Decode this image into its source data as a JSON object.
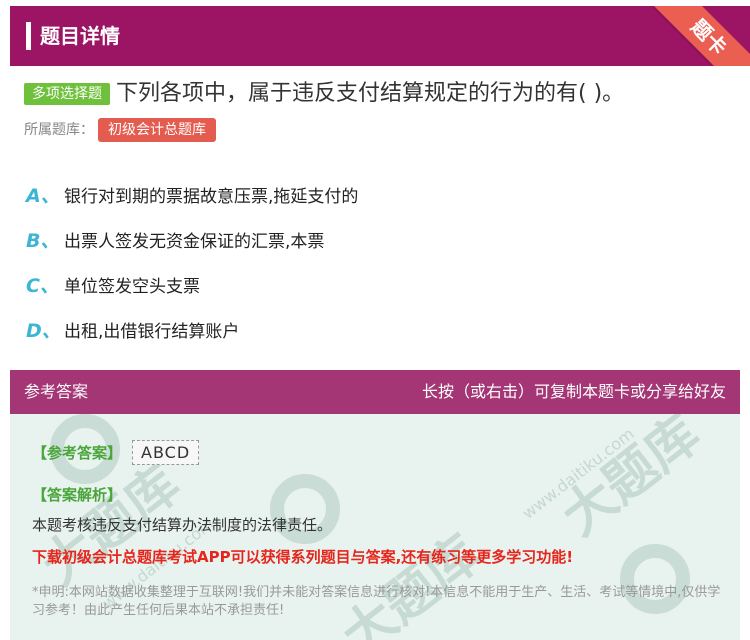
{
  "header": {
    "title": "题目详情",
    "ribbon": "题卡"
  },
  "question": {
    "type": "多项选择题",
    "text": "下列各项中，属于违反支付结算规定的行为的有( )。",
    "bank_label": "所属题库：",
    "bank_name": "初级会计总题库"
  },
  "options": [
    {
      "letter": "A、",
      "text": "银行对到期的票据故意压票,拖延支付的"
    },
    {
      "letter": "B、",
      "text": "出票人签发无资金保证的汇票,本票"
    },
    {
      "letter": "C、",
      "text": "单位签发空头支票"
    },
    {
      "letter": "D、",
      "text": "出租,出借银行结算账户"
    }
  ],
  "answer_bar": {
    "left": "参考答案",
    "right": "长按（或右击）可复制本题卡或分享给好友"
  },
  "answer": {
    "label": "【参考答案】",
    "value": "ABCD",
    "analysis_label": "【答案解析】",
    "analysis_text": "本题考核违反支付结算办法制度的法律责任。",
    "promo": "下载初级会计总题库考试APP可以获得系列题目与答案,还有练习等更多学习功能!",
    "disclaimer": "*申明:本网站数据收集整理于互联网!我们并未能对答案信息进行核对!本信息不能用于生产、生活、考试等情境中,仅供学习参考！由此产生任何后果本站不承担责任!"
  },
  "colors": {
    "header_bg": "#9c1464",
    "ribbon_bg": "#ea5f52",
    "qtype_bg": "#6fc13b",
    "bank_bg": "#e45c4f",
    "option_letter": "#3db5d3",
    "answer_bar_bg": "#a43675",
    "answer_body_bg": "#e8f3ef",
    "promo": "#e6251c"
  }
}
